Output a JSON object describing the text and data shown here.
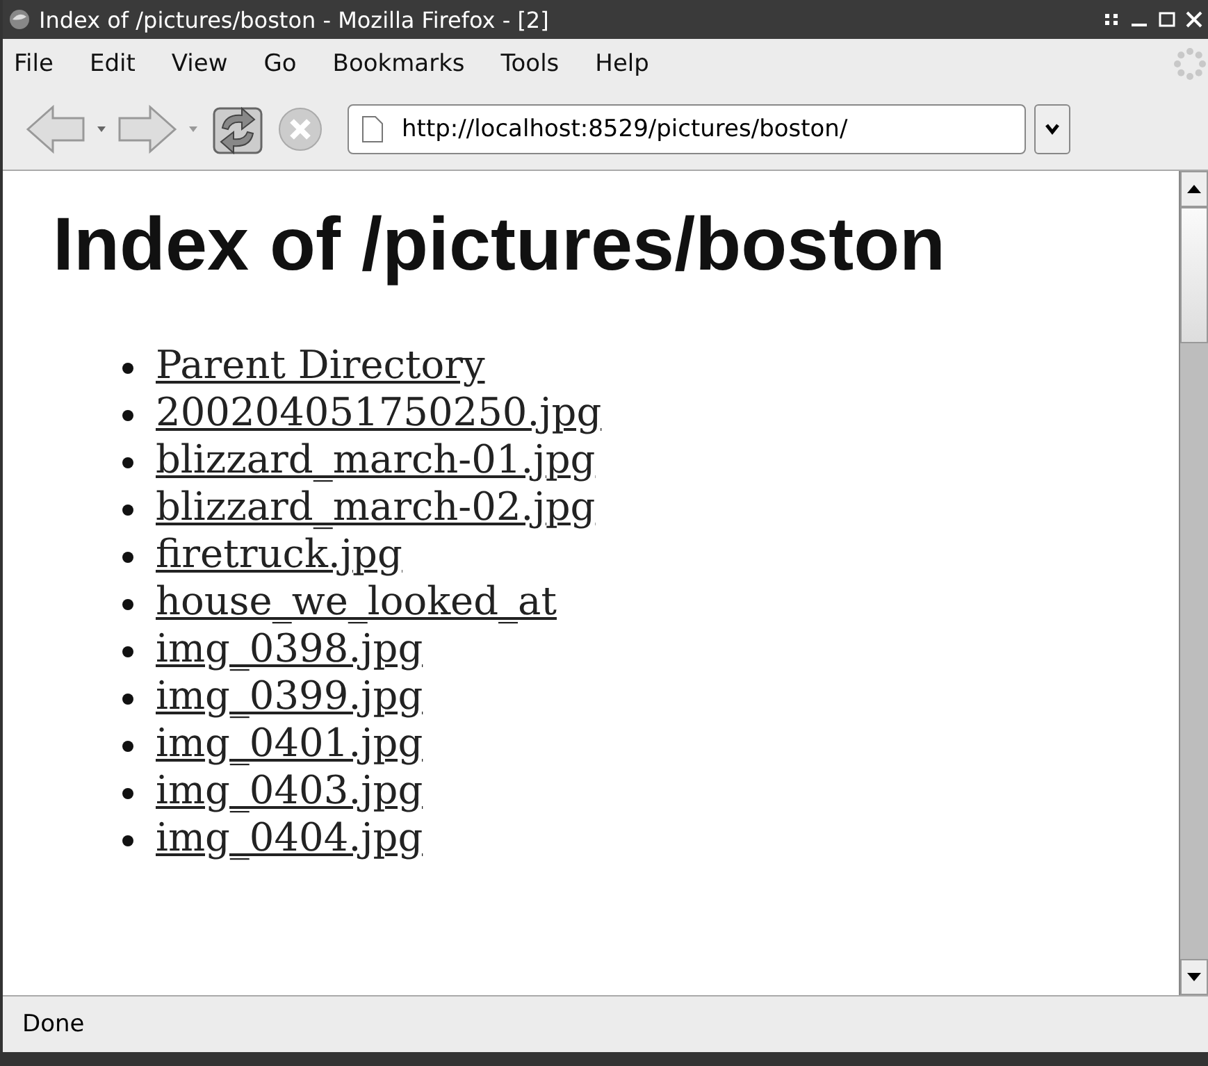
{
  "window": {
    "title": "Index of /pictures/boston - Mozilla Firefox - [2]"
  },
  "menu": [
    "File",
    "Edit",
    "View",
    "Go",
    "Bookmarks",
    "Tools",
    "Help"
  ],
  "address": {
    "value": "http://localhost:8529/pictures/boston/"
  },
  "page": {
    "heading": "Index of /pictures/boston",
    "links": [
      "Parent Directory",
      "200204051750250.jpg",
      "blizzard_march-01.jpg",
      "blizzard_march-02.jpg",
      "firetruck.jpg",
      "house_we_looked_at",
      "img_0398.jpg",
      "img_0399.jpg",
      "img_0401.jpg",
      "img_0403.jpg",
      "img_0404.jpg"
    ]
  },
  "status_bar": "Done"
}
